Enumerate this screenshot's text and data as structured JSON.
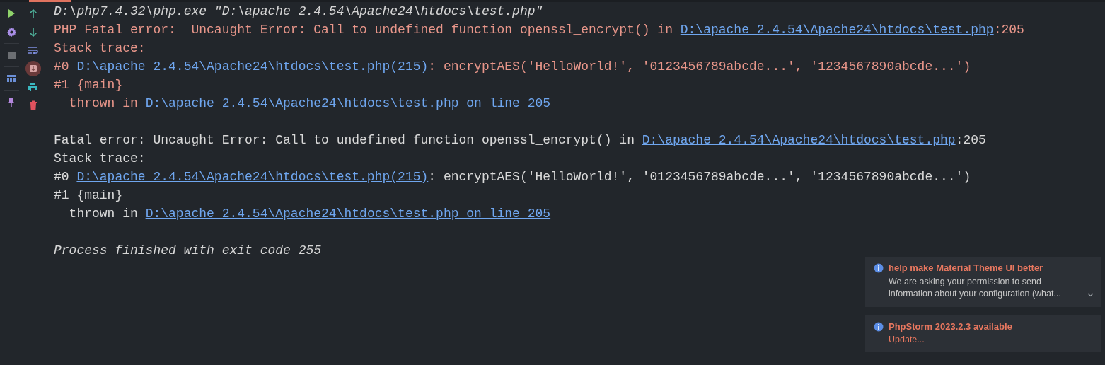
{
  "toolbar_left": [
    {
      "kind": "run",
      "on": false
    },
    {
      "kind": "settings",
      "on": false
    },
    {
      "kind": "stop",
      "on": false
    },
    {
      "kind": "layout",
      "on": false
    },
    {
      "kind": "pin",
      "on": false
    }
  ],
  "toolbar_right": [
    {
      "kind": "up",
      "on": false
    },
    {
      "kind": "down",
      "on": false
    },
    {
      "kind": "wrap",
      "on": false
    },
    {
      "kind": "scroll-end",
      "on": true
    },
    {
      "kind": "print",
      "on": false
    },
    {
      "kind": "trash",
      "on": false
    }
  ],
  "console_lines": [
    {
      "kind": "command",
      "segments": [
        {
          "kind": "text",
          "text": "D:\\php7.4.32\\php.exe \"D:\\apache 2.4.54\\Apache24\\htdocs\\test.php\""
        }
      ]
    },
    {
      "kind": "error",
      "segments": [
        {
          "kind": "text",
          "text": "PHP Fatal error:  Uncaught Error: Call to undefined function openssl_encrypt() in "
        },
        {
          "kind": "link",
          "text": "D:\\apache 2.4.54\\Apache24\\htdocs\\test.php"
        },
        {
          "kind": "text",
          "text": ":205"
        }
      ]
    },
    {
      "kind": "error",
      "segments": [
        {
          "kind": "text",
          "text": "Stack trace:"
        }
      ]
    },
    {
      "kind": "error",
      "segments": [
        {
          "kind": "text",
          "text": "#0 "
        },
        {
          "kind": "link",
          "text": "D:\\apache 2.4.54\\Apache24\\htdocs\\test.php(215)"
        },
        {
          "kind": "text",
          "text": ": encryptAES('HelloWorld!', '0123456789abcde...', '1234567890abcde...')"
        }
      ]
    },
    {
      "kind": "error",
      "segments": [
        {
          "kind": "text",
          "text": "#1 {main}"
        }
      ]
    },
    {
      "kind": "error",
      "segments": [
        {
          "kind": "text",
          "text": "  thrown in "
        },
        {
          "kind": "link",
          "text": "D:\\apache 2.4.54\\Apache24\\htdocs\\test.php on line 205"
        }
      ]
    },
    {
      "kind": "blank"
    },
    {
      "kind": "plain",
      "segments": [
        {
          "kind": "text",
          "text": "Fatal error: Uncaught Error: Call to undefined function openssl_encrypt() in "
        },
        {
          "kind": "link",
          "text": "D:\\apache 2.4.54\\Apache24\\htdocs\\test.php"
        },
        {
          "kind": "text",
          "text": ":205"
        }
      ]
    },
    {
      "kind": "plain",
      "segments": [
        {
          "kind": "text",
          "text": "Stack trace:"
        }
      ]
    },
    {
      "kind": "plain",
      "segments": [
        {
          "kind": "text",
          "text": "#0 "
        },
        {
          "kind": "link",
          "text": "D:\\apache 2.4.54\\Apache24\\htdocs\\test.php(215)"
        },
        {
          "kind": "text",
          "text": ": encryptAES('HelloWorld!', '0123456789abcde...', '1234567890abcde...')"
        }
      ]
    },
    {
      "kind": "plain",
      "segments": [
        {
          "kind": "text",
          "text": "#1 {main}"
        }
      ]
    },
    {
      "kind": "plain",
      "segments": [
        {
          "kind": "text",
          "text": "  thrown in "
        },
        {
          "kind": "link",
          "text": "D:\\apache 2.4.54\\Apache24\\htdocs\\test.php on line 205"
        }
      ]
    },
    {
      "kind": "blank"
    },
    {
      "kind": "finished",
      "segments": [
        {
          "kind": "text",
          "text": "Process finished with exit code 255"
        }
      ]
    }
  ],
  "notifications": [
    {
      "title": "help make Material Theme UI better",
      "body": "We are asking your permission to send information about your configuration (what...",
      "expandable": true
    },
    {
      "title": "PhpStorm 2023.2.3 available",
      "link": "Update...",
      "expandable": false
    }
  ]
}
